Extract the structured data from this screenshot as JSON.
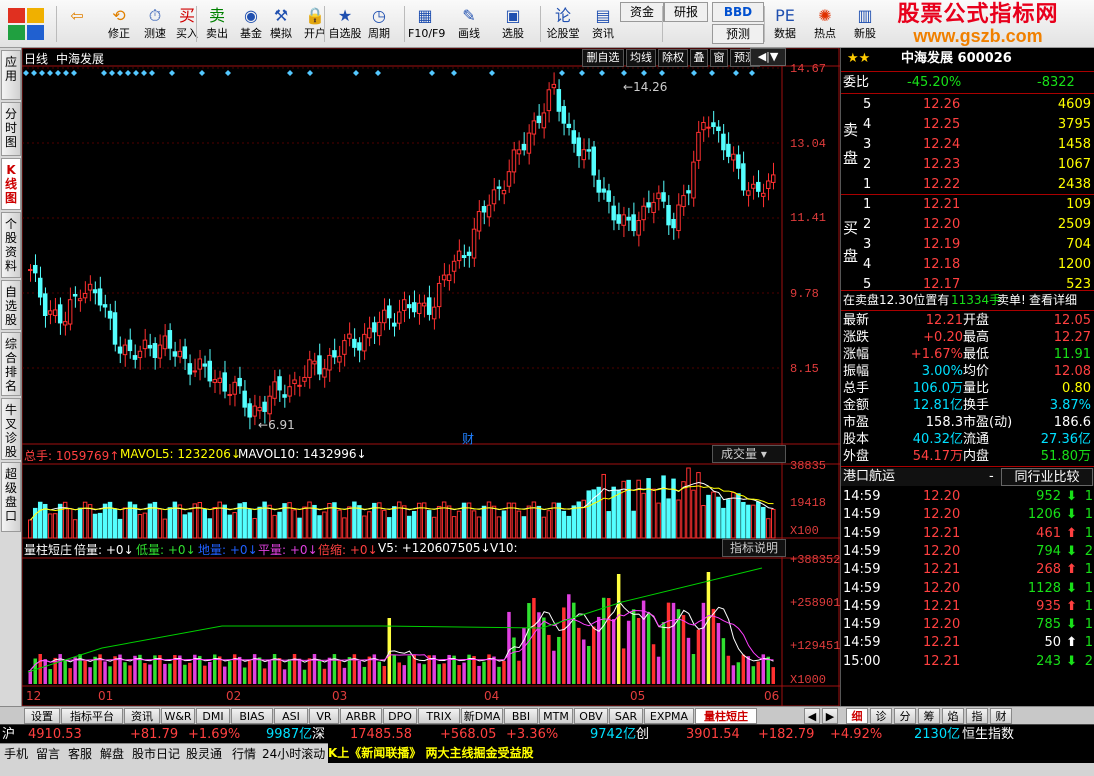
{
  "toolbar": {
    "buttons": [
      {
        "label": "",
        "icon": "back-arrow-icon"
      },
      {
        "label": "修正",
        "icon": "modify-icon"
      },
      {
        "label": "测速",
        "icon": "speed-test-icon"
      },
      {
        "label": "买入",
        "icon": "buy-icon"
      },
      {
        "label": "卖出",
        "icon": "sell-icon"
      },
      {
        "label": "基金",
        "icon": "fund-icon"
      },
      {
        "label": "模拟",
        "icon": "simulate-icon"
      },
      {
        "label": "开户",
        "icon": "open-account-icon"
      },
      {
        "label": "自选股",
        "icon": "watchlist-icon"
      },
      {
        "label": "周期",
        "icon": "period-icon"
      },
      {
        "label": "F10/F9",
        "icon": "f10-icon"
      },
      {
        "label": "画线",
        "icon": "draw-line-icon"
      },
      {
        "label": "选股",
        "icon": "stock-pick-icon"
      },
      {
        "label": "论股堂",
        "icon": "forum-icon"
      },
      {
        "label": "资讯",
        "icon": "news-icon"
      },
      {
        "label": "资金",
        "icon": "capital-icon"
      },
      {
        "label": "研报",
        "icon": "research-icon"
      },
      {
        "label": "BBD",
        "icon": "bbd-icon"
      },
      {
        "label": "预测",
        "icon": "forecast-icon"
      },
      {
        "label": "数据",
        "icon": "data-icon"
      },
      {
        "label": "热点",
        "icon": "hot-icon"
      },
      {
        "label": "新股",
        "icon": "new-stock-icon"
      }
    ],
    "brand_line1": "股票公式指标网",
    "brand_line2": "www.gszb.com"
  },
  "left_tabs": [
    "应用",
    "分时图",
    "K线图",
    "个股资料",
    "自选股",
    "综合排名",
    "牛叉诊股",
    "超级盘口"
  ],
  "chart": {
    "period": "日线",
    "stock_name": "中海发展",
    "top_buttons": [
      "删自选",
      "均线",
      "除权",
      "叠",
      "窗",
      "预测"
    ],
    "price_labels": [
      "14.67",
      "13.04",
      "11.41",
      "9.78",
      "8.15"
    ],
    "high_label": "14.26",
    "low_label": "6.91",
    "cai_label": "财",
    "vol_header": {
      "total": "总手: 1059769",
      "mavol5": "MAVOL5: 1232206",
      "mavol10": "MAVOL10: 1432996"
    },
    "vol_dropdown": "成交量",
    "vol_labels": [
      "38835",
      "19418",
      "X100"
    ],
    "ind_header": {
      "name": "量柱短庄",
      "beiliang": "倍量: +0",
      "diliang": "低量: +0",
      "diliang2": "地量: +0",
      "pingliang": "平量: +0",
      "beisuo": "倍缩: +0",
      "v5": "V5: +120607505",
      "v10": "V10:"
    },
    "ind_button": "指标说明",
    "ind_labels": [
      "+388352",
      "+258901",
      "+129451",
      "X1000"
    ],
    "x_labels": [
      "12",
      "01",
      "02",
      "03",
      "04",
      "05",
      "06"
    ],
    "colors": {
      "up": "#ff3030",
      "down": "#54ffff",
      "ma5": "#ffffff",
      "ma10": "#ffff00",
      "ind_line": "#00d000"
    }
  },
  "chart_data": {
    "type": "candlestick",
    "ylim": [
      6.5,
      14.67
    ],
    "high": 14.26,
    "low": 6.91,
    "approx_closes": [
      10.1,
      9.4,
      9.0,
      9.9,
      9.6,
      8.8,
      8.2,
      8.6,
      8.5,
      8.3,
      8.0,
      7.8,
      7.6,
      7.1,
      7.3,
      7.6,
      7.8,
      8.1,
      8.3,
      8.6,
      8.8,
      9.1,
      9.4,
      9.3,
      9.6,
      10.3,
      10.8,
      11.6,
      12.2,
      12.8,
      13.6,
      14.1,
      13.2,
      12.6,
      11.9,
      11.1,
      11.4,
      11.8,
      11.3,
      12.0,
      13.8,
      12.9,
      12.4,
      11.8,
      12.21
    ]
  },
  "quote": {
    "title": "中海发展 600026",
    "weibi_label": "委比",
    "weibi_pct": "-45.20%",
    "weibi_diff": "-8322",
    "sell_label_1": "卖",
    "sell_label_2": "盘",
    "buy_label_1": "买",
    "buy_label_2": "盘",
    "asks": [
      {
        "lvl": "5",
        "price": "12.26",
        "vol": "4609"
      },
      {
        "lvl": "4",
        "price": "12.25",
        "vol": "3795"
      },
      {
        "lvl": "3",
        "price": "12.24",
        "vol": "1458"
      },
      {
        "lvl": "2",
        "price": "12.23",
        "vol": "1067"
      },
      {
        "lvl": "1",
        "price": "12.22",
        "vol": "2438"
      }
    ],
    "bids": [
      {
        "lvl": "1",
        "price": "12.21",
        "vol": "109"
      },
      {
        "lvl": "2",
        "price": "12.20",
        "vol": "2509"
      },
      {
        "lvl": "3",
        "price": "12.19",
        "vol": "704"
      },
      {
        "lvl": "4",
        "price": "12.18",
        "vol": "1200"
      },
      {
        "lvl": "5",
        "price": "12.17",
        "vol": "523"
      }
    ],
    "notice": {
      "prefix": "在卖盘12.30位置有",
      "qty": "11334手",
      "suffix": "卖单!",
      "link": "查看详细"
    },
    "stats": [
      {
        "l1": "最新",
        "v1": "12.21",
        "l2": "开盘",
        "v2": "12.05"
      },
      {
        "l1": "涨跌",
        "v1": "+0.20",
        "l2": "最高",
        "v2": "12.27"
      },
      {
        "l1": "涨幅",
        "v1": "+1.67%",
        "l2": "最低",
        "v2": "11.91"
      },
      {
        "l1": "振幅",
        "v1": "3.00%",
        "l2": "均价",
        "v2": "12.08"
      },
      {
        "l1": "总手",
        "v1": "106.0万",
        "l2": "量比",
        "v2": "0.80"
      },
      {
        "l1": "金额",
        "v1": "12.81亿",
        "l2": "换手",
        "v2": "3.87%"
      },
      {
        "l1": "市盈",
        "v1": "158.3",
        "l2": "市盈(动)",
        "v2": "186.6"
      },
      {
        "l1": "股本",
        "v1": "40.32亿",
        "l2": "流通",
        "v2": "27.36亿"
      },
      {
        "l1": "外盘",
        "v1": "54.17万",
        "l2": "内盘",
        "v2": "51.80万"
      }
    ],
    "industry": "港口航运",
    "industry_dash": "-",
    "compare_button": "同行业比较",
    "ticks": [
      {
        "time": "14:59",
        "price": "12.20",
        "vol": "952",
        "dir": "down",
        "n": "1"
      },
      {
        "time": "14:59",
        "price": "12.20",
        "vol": "1206",
        "dir": "down",
        "n": "1"
      },
      {
        "time": "14:59",
        "price": "12.21",
        "vol": "461",
        "dir": "up",
        "n": "1"
      },
      {
        "time": "14:59",
        "price": "12.20",
        "vol": "794",
        "dir": "down",
        "n": "2"
      },
      {
        "time": "14:59",
        "price": "12.21",
        "vol": "268",
        "dir": "up",
        "n": "1"
      },
      {
        "time": "14:59",
        "price": "12.20",
        "vol": "1128",
        "dir": "down",
        "n": "1"
      },
      {
        "time": "14:59",
        "price": "12.21",
        "vol": "935",
        "dir": "up",
        "n": "1"
      },
      {
        "time": "14:59",
        "price": "12.20",
        "vol": "785",
        "dir": "down",
        "n": "1"
      },
      {
        "time": "14:59",
        "price": "12.21",
        "vol": "50",
        "dir": "neutral",
        "n": "1"
      },
      {
        "time": "15:00",
        "price": "12.21",
        "vol": "243",
        "dir": "down",
        "n": "2"
      }
    ]
  },
  "bottom_tabs": [
    "设置",
    "指标平台",
    "资讯",
    "W&R",
    "DMI",
    "BIAS",
    "ASI",
    "VR",
    "ARBR",
    "DPO",
    "TRIX",
    "新DMA",
    "BBI",
    "MTM",
    "OBV",
    "SAR",
    "EXPMA",
    "量柱短庄"
  ],
  "right_tabs": [
    "细",
    "诊",
    "分",
    "筹",
    "焰",
    "指",
    "财"
  ],
  "index_bar": {
    "sh_label": "沪",
    "sh_value": "4910.53",
    "sh_change": "+81.79",
    "sh_pct": "+1.69%",
    "sh_amount": "9987亿",
    "sz_label": "深",
    "sz_value": "17485.58",
    "sz_change": "+568.05",
    "sz_pct": "+3.36%",
    "cy_amount": "9742亿",
    "cy_label": "创",
    "cy_value": "3901.54",
    "cy_change": "+182.79",
    "cy_pct": "+4.92%",
    "hs_amount": "2130亿",
    "hs_label": "恒生指数"
  },
  "status_bar": {
    "items": [
      "手机",
      "留言",
      "客服",
      "解盘",
      "股市日记",
      "股灵通",
      "行情",
      "24小时滚动"
    ],
    "ticker": "K上《新闻联播》 两大主线掘金受益股"
  }
}
